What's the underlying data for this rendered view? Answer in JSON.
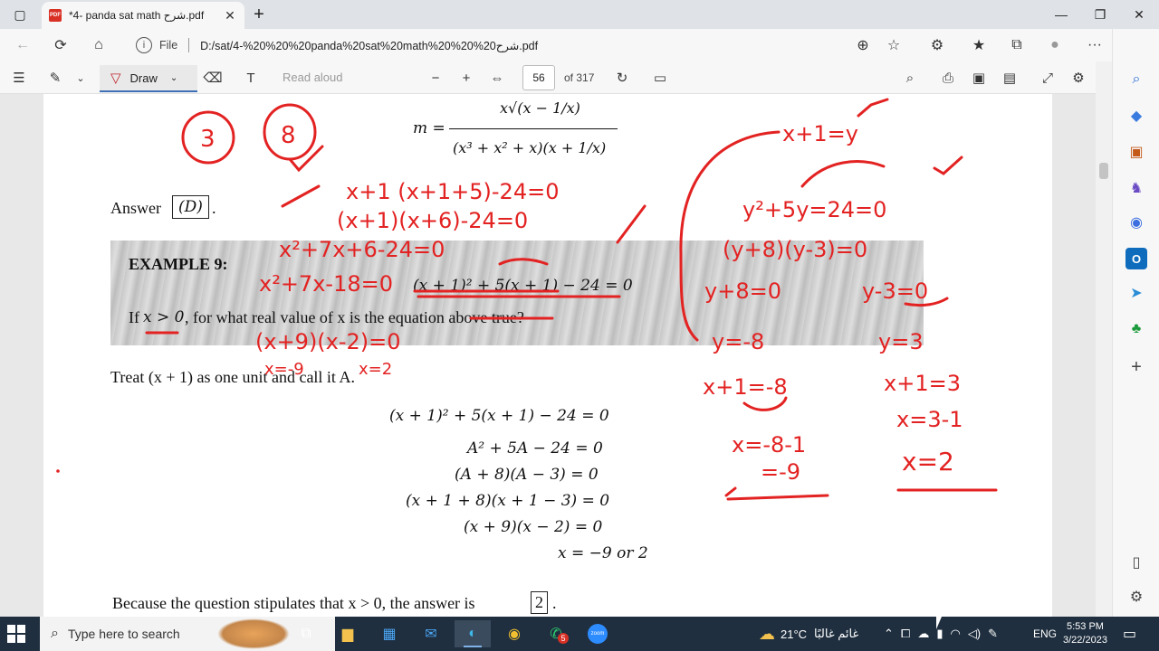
{
  "browser": {
    "tab": {
      "badge": "PDF",
      "title": "*4- panda sat math شرح.pdf",
      "close": "✕"
    },
    "new_tab": "+",
    "window_controls": {
      "minimize": "—",
      "restore": "❐",
      "close": "✕"
    },
    "nav": {
      "back": "←",
      "reload": "⟳",
      "home": "⌂"
    },
    "address": {
      "info": "i",
      "file_label": "File",
      "url": "D:/sat/4-%20%20%20panda%20sat%20math%20%20%20شرح.pdf"
    },
    "actions": {
      "zoom": "⊕",
      "favorite_add": "☆",
      "extensions": "⚙",
      "favorites": "★",
      "collections": "⧉",
      "profile": "●",
      "more": "···",
      "bing": "b"
    }
  },
  "pdf_toolbar": {
    "contents": "☰",
    "highlight": "✎",
    "highlight_chevron": "⌄",
    "draw_label": "Draw",
    "draw_pen": "▽",
    "draw_chevron": "⌄",
    "eraser": "⌫",
    "text": "T",
    "read_aloud": "Read aloud",
    "zoom_out": "−",
    "zoom_in": "+",
    "fit": "⇔",
    "page_current": "56",
    "page_total": "of 317",
    "rotate": "↻",
    "page_view": "▭",
    "search": "⌕",
    "print": "⎙",
    "save": "▣",
    "save_as": "▤",
    "fullscreen": "⤢",
    "settings": "⚙"
  },
  "document": {
    "formula_top": {
      "m_eq": "m =",
      "numerator": "x√(x − 1/x)",
      "denominator": "(x³ + x² + x)(x + 1/x)"
    },
    "answer": {
      "label": "Answer",
      "value": "(D)",
      "period": "."
    },
    "example": {
      "title": "EXAMPLE 9:",
      "equation": "(x + 1)² + 5(x + 1) − 24 = 0",
      "question_start": "If",
      "question_math": "x > 0",
      "question_end": ", for what real value of x is the equation above true?"
    },
    "treat_line": "Treat (x + 1) as one unit and call it A.",
    "steps": [
      "(x + 1)² + 5(x + 1) − 24 = 0",
      "A² + 5A − 24 = 0",
      "(A + 8)(A − 3) = 0",
      "(x + 1 + 8)(x + 1 − 3) = 0",
      "(x + 9)(x − 2) = 0",
      "x = −9 or 2"
    ],
    "conclusion": {
      "text": "Because the question stipulates that x > 0, the answer is",
      "answer": "2",
      "period": "."
    }
  },
  "annotations": [
    "3",
    "8",
    "x+1 (x+1+5)-24=0",
    "(x+1)(x+6)-24=0",
    "x²+7x+6-24=0",
    "x²+7x-18=0",
    "(x+9)(x-2)=0",
    "x=-9",
    "x=2",
    "x+1=y",
    "y²+5y=24=0",
    "(y+8)(y-3)=0",
    "y+8=0",
    "y-3=0",
    "y=-8",
    "y=3",
    "x+1=-8",
    "x+1=3",
    "x=-8-1",
    "=-9",
    "x=3-1",
    "x=2"
  ],
  "sidebar": {
    "search": "⌕",
    "tag": "◆",
    "tools": "▣",
    "games": "♞",
    "office": "◉",
    "outlook": "O",
    "send": "➤",
    "tree": "♣",
    "add": "+",
    "panel": "▯",
    "settings": "⚙"
  },
  "taskbar": {
    "search_placeholder": "Type here to search",
    "weather_temp": "21°C",
    "weather_desc": "غائم غالبًا",
    "language": "ENG",
    "time": "5:53 PM",
    "date": "3/22/2023",
    "whatsapp_badge": "5",
    "zoom_label": "zoom"
  },
  "colors": {
    "ink": "#e32222",
    "accent": "#3f6fb5",
    "taskbar": "#1f2f3f"
  }
}
